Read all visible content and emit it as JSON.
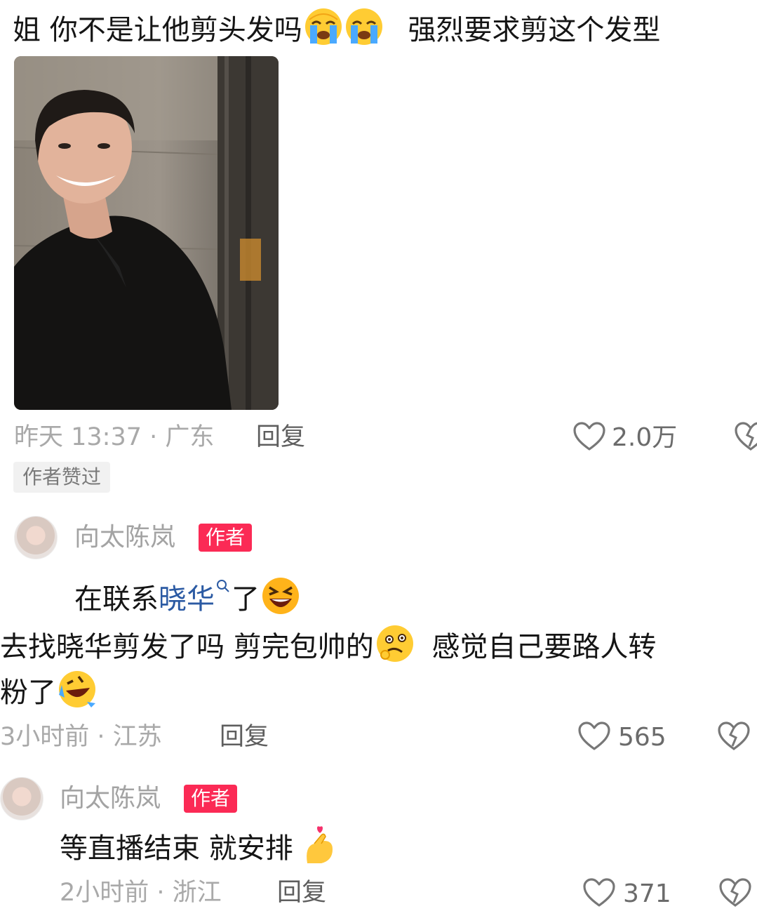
{
  "comment1": {
    "text": "姐 你不是让他剪头发吗",
    "text_tail": "强烈要求剪这个发型",
    "meta": "昨天 13:37 · 广东",
    "reply": "回复",
    "likes": "2.0万",
    "author_liked": "作者赞过"
  },
  "reply1": {
    "name": "向太陈岚",
    "badge": "作者",
    "text_before": "在联系",
    "link": "晓华",
    "text_after": "了"
  },
  "comment2": {
    "line1_a": "去找晓华剪发了吗 剪完包帅的",
    "line1_b": "感觉自己要路人转",
    "line2": "粉了",
    "meta": "3小时前 · 江苏",
    "reply": "回复",
    "likes": "565"
  },
  "reply2": {
    "name": "向太陈岚",
    "badge": "作者",
    "text": "等直播结束 就安排",
    "meta": "2小时前 · 浙江",
    "reply": "回复",
    "likes": "371"
  },
  "icons": {
    "crying": "loudly-crying-face-emoji",
    "grinning": "grinning-squinting-face-emoji",
    "drooling": "woozy-face-emoji",
    "laughing": "rolling-on-floor-laughing-emoji",
    "heart_hand": "finger-heart-emoji",
    "like": "heart-outline-icon",
    "dislike": "broken-heart-outline-icon",
    "search_hint": "search-icon"
  },
  "colors": {
    "badge": "#fb2a55",
    "link": "#2b5aa3",
    "meta": "#a9a9a9"
  }
}
